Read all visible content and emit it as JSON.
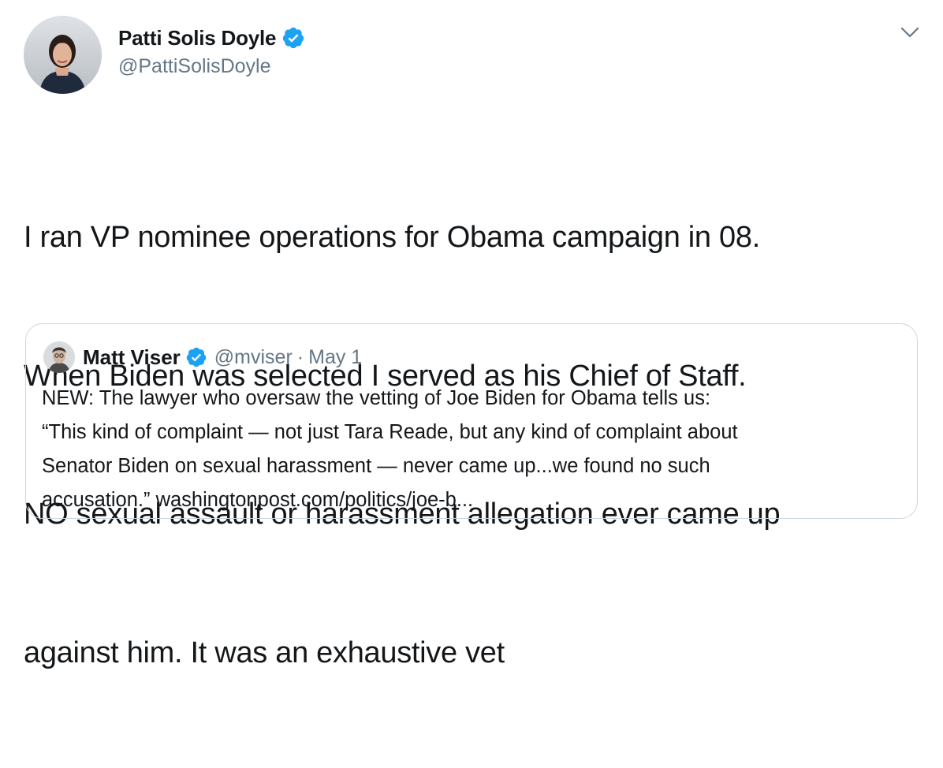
{
  "author": {
    "display_name": "Patti Solis Doyle",
    "handle": "@PattiSolisDoyle",
    "verified_icon": "verified-badge-icon",
    "avatar_icon": "profile-avatar"
  },
  "menu_icon": "chevron-down-icon",
  "tweet": {
    "lines": [
      "I ran VP nominee operations for Obama campaign in 08.",
      "When Biden was selected I served as his Chief of Staff.",
      "NO sexual assault or harassment allegation ever came up",
      "against him. It was an exhaustive vet"
    ]
  },
  "quoted_tweet": {
    "display_name": "Matt Viser",
    "handle": "@mviser",
    "separator": "·",
    "date": "May 1",
    "lines": [
      "NEW: The lawyer who oversaw the vetting of Joe Biden for Obama tells us:",
      "“This kind of complaint — not just Tara Reade, but any kind of complaint about",
      "Senator Biden on sexual harassment — never came up...we found no such",
      "accusation.” washingtonpost.com/politics/joe-b..."
    ]
  },
  "colors": {
    "text": "#14171a",
    "secondary": "#657786",
    "verified": "#1da1f2",
    "border": "#ccd6dd"
  }
}
